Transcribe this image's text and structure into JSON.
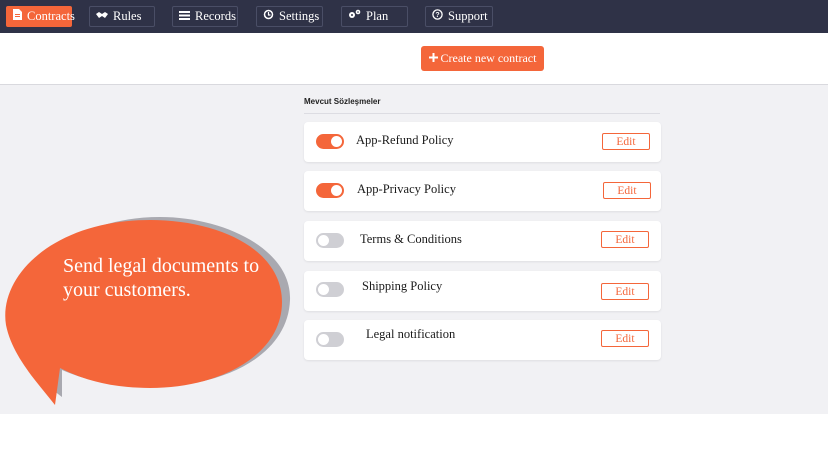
{
  "nav": {
    "items": [
      {
        "label": "Contracts",
        "icon": "document-icon"
      },
      {
        "label": "Rules",
        "icon": "handshake-icon"
      },
      {
        "label": "Records",
        "icon": "list-icon"
      },
      {
        "label": "Settings",
        "icon": "history-icon"
      },
      {
        "label": "Plan",
        "icon": "gears-icon"
      },
      {
        "label": "Support",
        "icon": "question-circle-icon"
      }
    ],
    "active": "Contracts"
  },
  "header": {
    "create_button_label": "Create new contract",
    "create_icon": "plus-icon"
  },
  "contracts": {
    "section_title": "Mevcut Sözleşmeler",
    "edit_label": "Edit",
    "items": [
      {
        "label": "App-Refund Policy",
        "enabled": true
      },
      {
        "label": "App-Privacy Policy",
        "enabled": true
      },
      {
        "label": "Terms & Conditions",
        "enabled": false
      },
      {
        "label": "Shipping Policy",
        "enabled": false
      },
      {
        "label": "Legal notification",
        "enabled": false
      }
    ]
  },
  "promo": {
    "text": "Send legal documents to your customers."
  },
  "colors": {
    "accent": "#f4663a",
    "nav_bg": "#2f3247",
    "content_bg": "#f1f1f4",
    "toggle_off": "#cfcfd4"
  }
}
